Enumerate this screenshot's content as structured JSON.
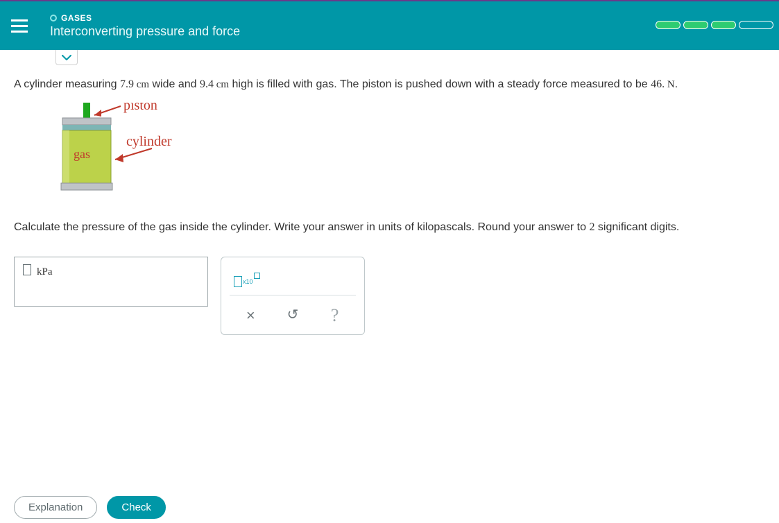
{
  "header": {
    "category": "GASES",
    "title": "Interconverting pressure and force"
  },
  "problem": {
    "prefix": "A cylinder measuring ",
    "width_val": "7.9",
    "width_unit": " cm",
    "mid1": " wide and ",
    "height_val": "9.4",
    "height_unit": " cm",
    "mid2": " high is filled with gas. The piston is pushed down with a steady force measured to be ",
    "force_val": "46.",
    "force_unit": " N",
    "suffix": "."
  },
  "diagram": {
    "piston_label": "piston",
    "cylinder_label": "cylinder",
    "gas_label": "gas"
  },
  "instruction": {
    "prefix": "Calculate the pressure of the gas inside the cylinder. Write your answer in units of kilopascals. Round your answer to ",
    "sig_val": "2",
    "suffix": " significant digits."
  },
  "answer": {
    "unit_label": "kPa",
    "sci_sub": "x10"
  },
  "footer": {
    "explanation": "Explanation",
    "check": "Check"
  },
  "icons": {
    "clear": "×",
    "reset": "↺",
    "help": "?"
  }
}
